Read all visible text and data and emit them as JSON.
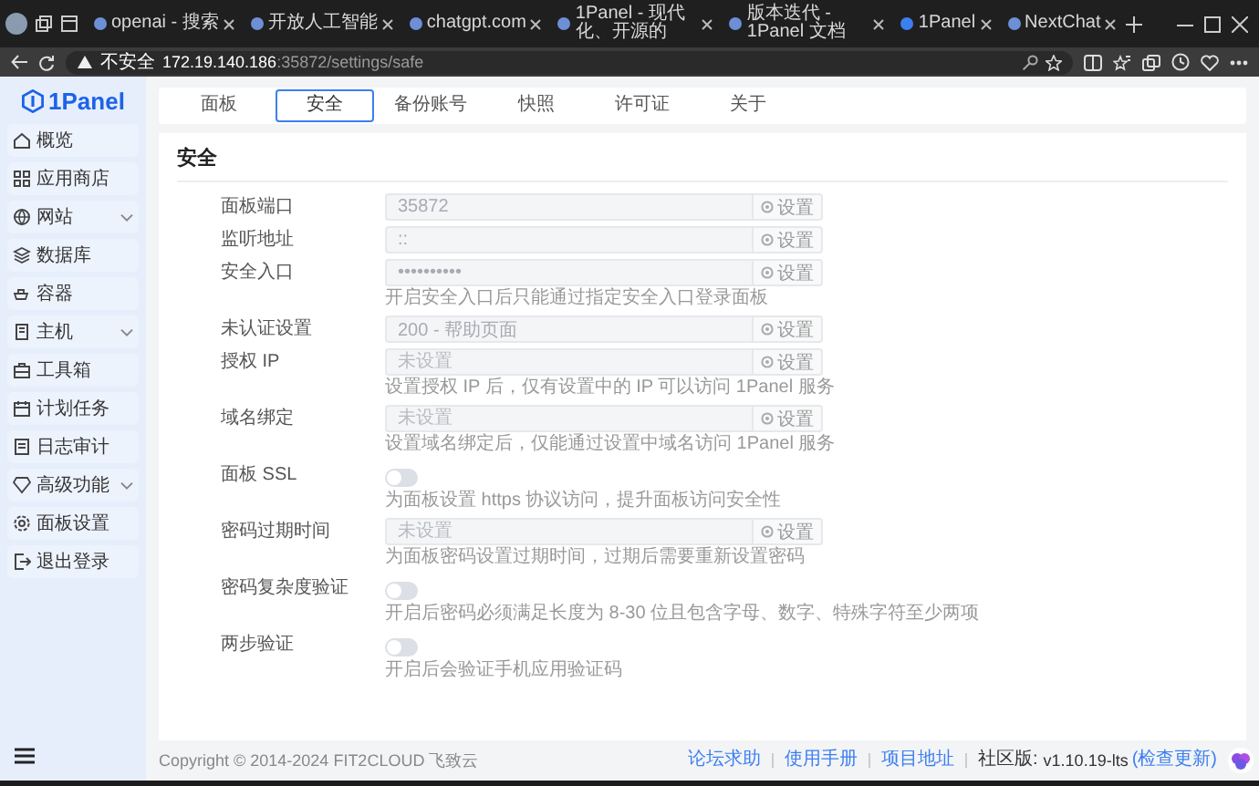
{
  "browser": {
    "tabs": [
      {
        "title": "openai - 搜索",
        "selected": false
      },
      {
        "title": "开放人工智能",
        "selected": false
      },
      {
        "title": "chatgpt.com",
        "selected": false
      },
      {
        "title": "1Panel - 现代化、开源的",
        "selected": false
      },
      {
        "title": "版本迭代 - 1Panel 文档",
        "selected": false
      },
      {
        "title": "1Panel",
        "selected": true
      },
      {
        "title": "NextChat",
        "selected": false
      }
    ],
    "address": {
      "security": "不安全",
      "host": "172.19.140.186",
      "path": ":35872/settings/safe"
    }
  },
  "sidebar": {
    "logo": "1Panel",
    "items": [
      {
        "label": "概览",
        "expandable": false
      },
      {
        "label": "应用商店",
        "expandable": false
      },
      {
        "label": "网站",
        "expandable": true
      },
      {
        "label": "数据库",
        "expandable": false
      },
      {
        "label": "容器",
        "expandable": false
      },
      {
        "label": "主机",
        "expandable": true
      },
      {
        "label": "工具箱",
        "expandable": false
      },
      {
        "label": "计划任务",
        "expandable": false
      },
      {
        "label": "日志审计",
        "expandable": false
      },
      {
        "label": "高级功能",
        "expandable": true
      },
      {
        "label": "面板设置",
        "expandable": false
      },
      {
        "label": "退出登录",
        "expandable": false
      }
    ]
  },
  "settings_tabs": [
    {
      "label": "面板",
      "selected": false
    },
    {
      "label": "安全",
      "selected": true
    },
    {
      "label": "备份账号",
      "selected": false
    },
    {
      "label": "快照",
      "selected": false
    },
    {
      "label": "许可证",
      "selected": false
    },
    {
      "label": "关于",
      "selected": false
    }
  ],
  "panel": {
    "title": "安全",
    "rows": [
      {
        "kind": "input",
        "label": "面板端口",
        "value": "35872",
        "button": "设置"
      },
      {
        "kind": "input",
        "label": "监听地址",
        "value": "::",
        "button": "设置"
      },
      {
        "kind": "input",
        "label": "安全入口",
        "value": "••••••••••",
        "button": "设置",
        "hint": "开启安全入口后只能通过指定安全入口登录面板"
      },
      {
        "kind": "input",
        "label": "未认证设置",
        "value": "200 - 帮助页面",
        "button": "设置"
      },
      {
        "kind": "input",
        "label": "授权 IP",
        "placeholder": "未设置",
        "button": "设置",
        "hint": "设置授权 IP 后，仅有设置中的 IP 可以访问 1Panel 服务"
      },
      {
        "kind": "input",
        "label": "域名绑定",
        "placeholder": "未设置",
        "button": "设置",
        "hint": "设置域名绑定后，仅能通过设置中域名访问 1Panel 服务"
      },
      {
        "kind": "switch",
        "label": "面板 SSL",
        "on": false,
        "hint": "为面板设置 https 协议访问，提升面板访问安全性"
      },
      {
        "kind": "input",
        "label": "密码过期时间",
        "placeholder": "未设置",
        "button": "设置",
        "hint": "为面板密码设置过期时间，过期后需要重新设置密码"
      },
      {
        "kind": "switch",
        "label": "密码复杂度验证",
        "on": false,
        "hint": "开启后密码必须满足长度为 8-30 位且包含字母、数字、特殊字符至少两项"
      },
      {
        "kind": "switch",
        "label": "两步验证",
        "on": false,
        "hint": "开启后会验证手机应用验证码"
      }
    ]
  },
  "footer": {
    "copyright": "Copyright © 2014-2024 FIT2CLOUD 飞致云",
    "links": [
      "论坛求助",
      "使用手册",
      "项目地址"
    ],
    "edition": "社区版:",
    "version": "v1.10.19-lts",
    "update": "(检查更新)"
  }
}
